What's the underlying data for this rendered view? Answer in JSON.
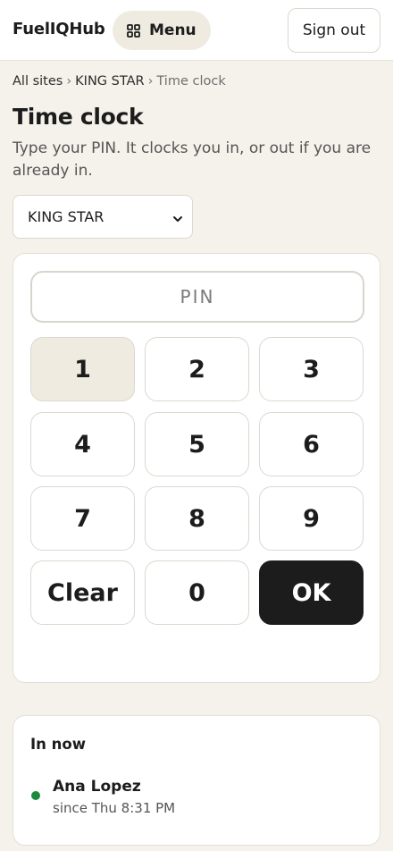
{
  "header": {
    "brand": "FuelIQHub",
    "menu_label": "Menu",
    "signout_label": "Sign out"
  },
  "breadcrumb": {
    "items": [
      "All sites",
      "KING STAR",
      "Time clock"
    ],
    "separator": "›"
  },
  "page": {
    "title": "Time clock",
    "subtitle": "Type your PIN. It clocks you in, or out if you are already in."
  },
  "site_select": {
    "selected": "KING STAR"
  },
  "keypad": {
    "pin_placeholder": "PIN",
    "pin_value": "",
    "keys": [
      "1",
      "2",
      "3",
      "4",
      "5",
      "6",
      "7",
      "8",
      "9",
      "Clear",
      "0",
      "OK"
    ],
    "highlighted_key": "1"
  },
  "in_now": {
    "title": "In now",
    "employees": [
      {
        "name": "Ana Lopez",
        "since": "since Thu 8:31 PM",
        "status_color": "#1b8a3e"
      }
    ]
  },
  "colors": {
    "background": "#f5f2eb",
    "accent_dark": "#1c1c1c",
    "status_in": "#1b8a3e"
  },
  "icons": {
    "menu": "grid-icon",
    "select": "chevron-down-icon"
  }
}
